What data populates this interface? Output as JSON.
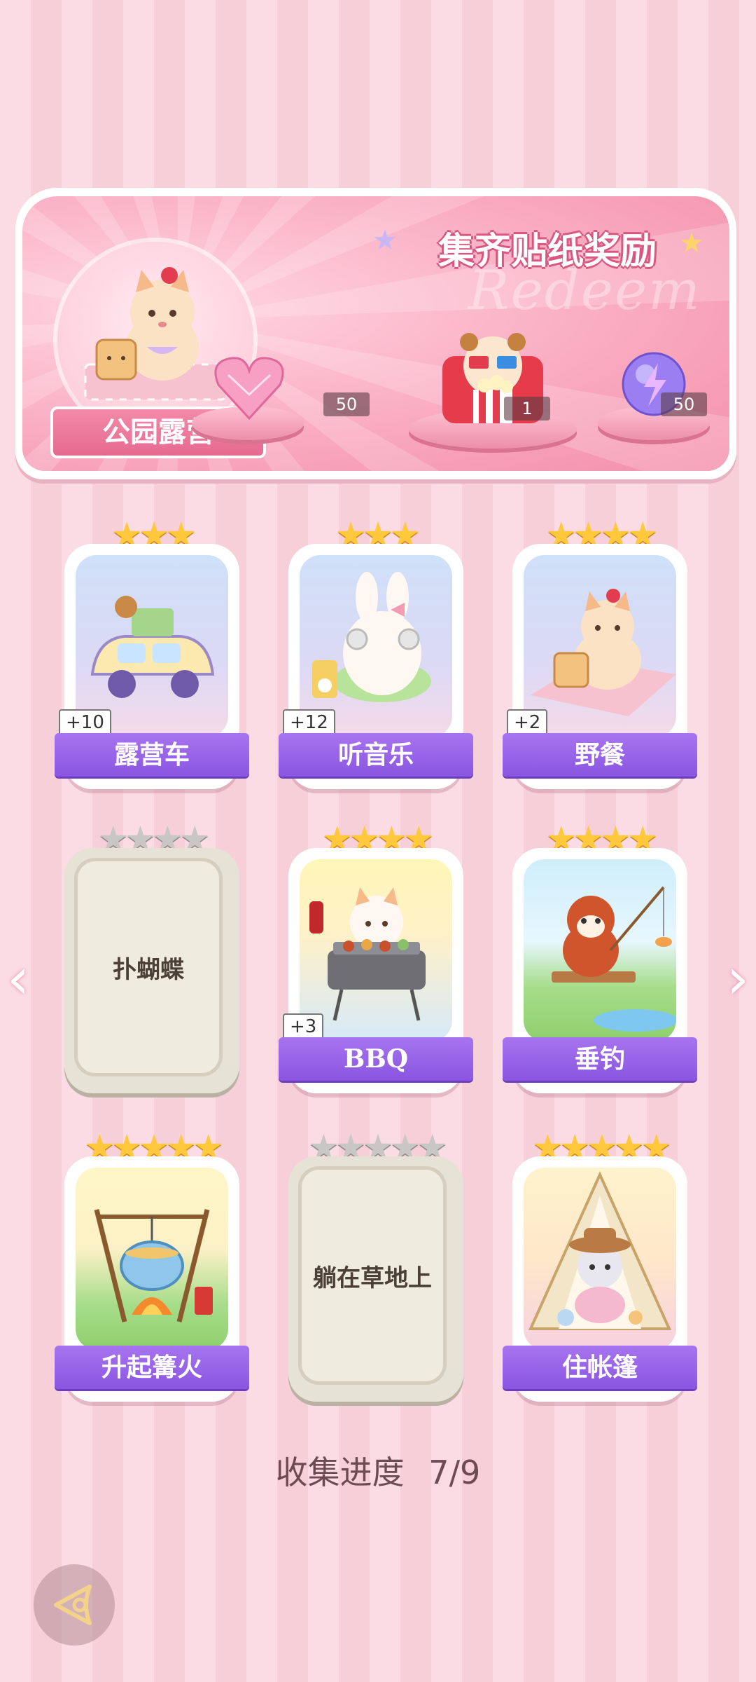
{
  "reward_panel": {
    "title": "集齐贴纸奖励",
    "watermark": "Redeem",
    "theme_name": "公园露营",
    "rewards": [
      {
        "icon": "pink-heart-gem-icon",
        "count": "50"
      },
      {
        "icon": "popcorn-bear-icon",
        "count": "1"
      },
      {
        "icon": "purple-energy-orb-icon",
        "count": "50"
      }
    ]
  },
  "cards": [
    {
      "label": "露营车",
      "stars": 3,
      "unlocked": true,
      "bonus": "+10"
    },
    {
      "label": "听音乐",
      "stars": 3,
      "unlocked": true,
      "bonus": "+12"
    },
    {
      "label": "野餐",
      "stars": 4,
      "unlocked": true,
      "bonus": "+2"
    },
    {
      "label": "扑蝴蝶",
      "stars": 4,
      "unlocked": false,
      "bonus": ""
    },
    {
      "label": "BBQ",
      "stars": 4,
      "unlocked": true,
      "bonus": "+3"
    },
    {
      "label": "垂钓",
      "stars": 4,
      "unlocked": true,
      "bonus": ""
    },
    {
      "label": "升起篝火",
      "stars": 5,
      "unlocked": true,
      "bonus": ""
    },
    {
      "label": "躺在草地上",
      "stars": 5,
      "unlocked": false,
      "bonus": ""
    },
    {
      "label": "住帐篷",
      "stars": 5,
      "unlocked": true,
      "bonus": ""
    }
  ],
  "progress": {
    "label": "收集进度",
    "value": "7/9"
  },
  "nav": {
    "prev": "‹",
    "next": "›"
  },
  "colors": {
    "accent": "#8a55e0",
    "pink": "#f38fab",
    "gold_star": "#ffc83d",
    "grey_star": "#c9c6c6"
  }
}
